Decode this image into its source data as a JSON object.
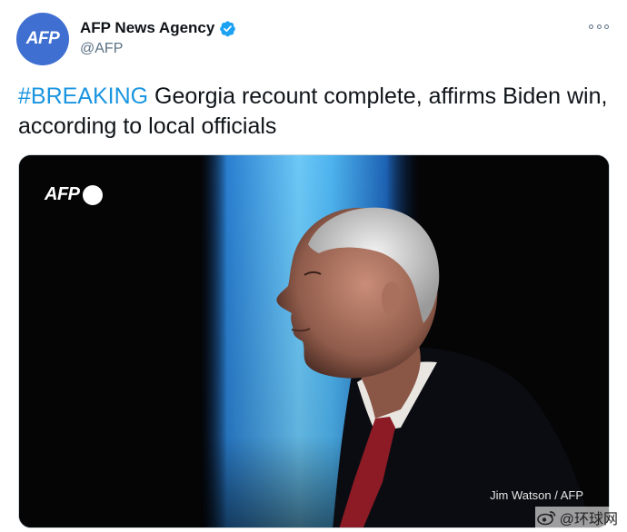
{
  "account": {
    "avatar_text": "AFP",
    "display_name": "AFP News Agency",
    "handle": "@AFP",
    "verified": true
  },
  "tweet": {
    "hashtag": "#BREAKING",
    "text": " Georgia recount complete, affirms Biden win, according to local officials"
  },
  "media": {
    "logo_text": "AFP",
    "credit": "Jim Watson / AFP",
    "description": ""
  },
  "watermark": {
    "text": "@环球网"
  },
  "colors": {
    "avatar_bg": "#3f6fd0",
    "hashtag": "#1b95e0",
    "verified": "#1da1f2",
    "handle": "#5b7083",
    "media_bg": "#050506",
    "backlight": "#4cb6f0"
  },
  "icons": {
    "verified": "verified-badge-icon",
    "more": "more-options-icon",
    "watermark": "weibo-icon"
  }
}
